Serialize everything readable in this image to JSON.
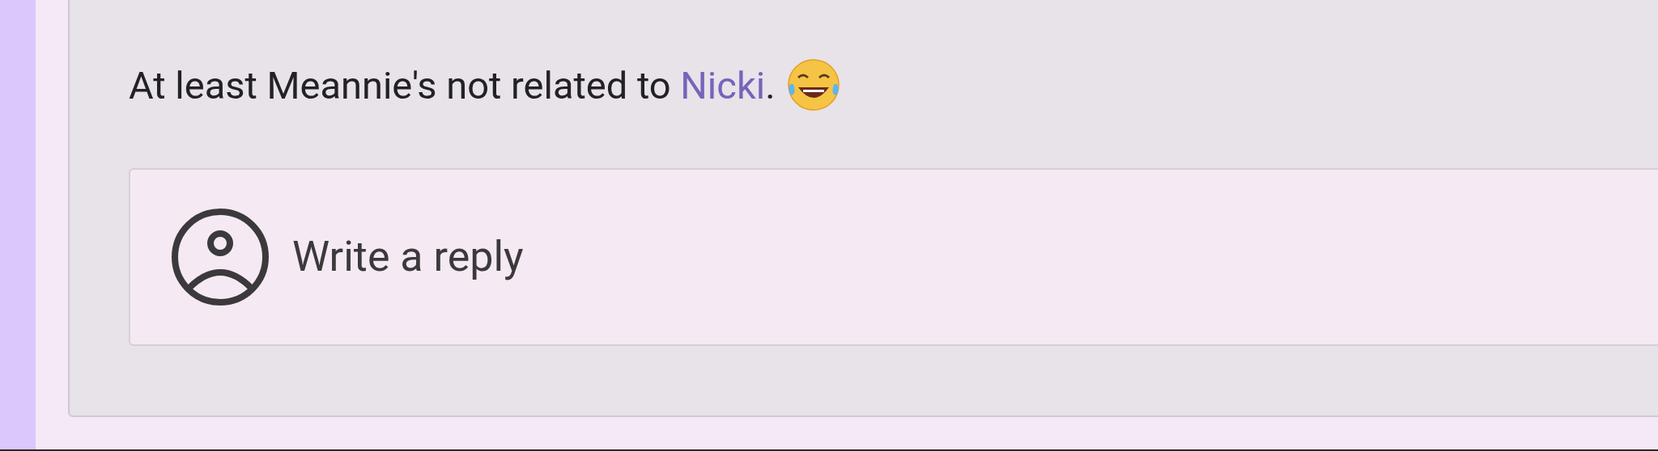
{
  "comment": {
    "text_before_link": "At least Meannie's not related to ",
    "link": "Nicki",
    "text_after_link": "."
  },
  "reply_field": {
    "placeholder": "Write a reply"
  }
}
